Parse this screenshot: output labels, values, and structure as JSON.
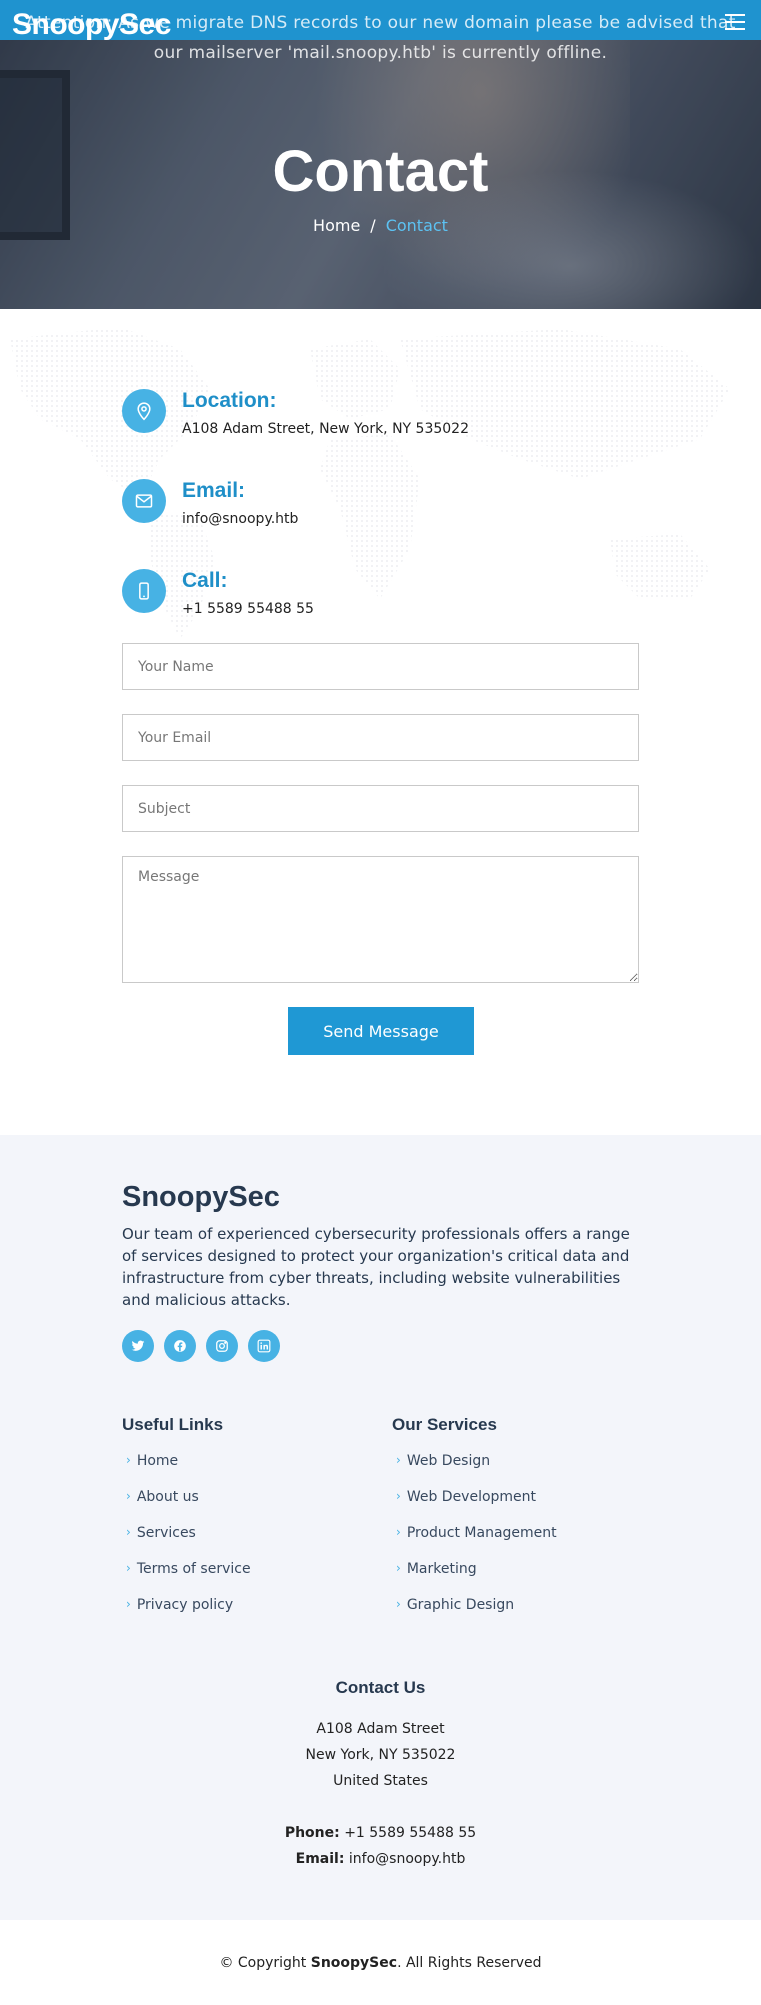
{
  "header": {
    "logo": "SnoopySec",
    "notice": "Attention: As we migrate DNS records to our new domain please be advised that our mailserver 'mail.snoopy.htb' is currently offline."
  },
  "hero": {
    "title": "Contact",
    "breadcrumb": {
      "home": "Home",
      "separator": "/",
      "current": "Contact"
    }
  },
  "contact_info": [
    {
      "icon": "location-pin-icon",
      "title": "Location:",
      "value": "A108 Adam Street, New York, NY 535022"
    },
    {
      "icon": "envelope-icon",
      "title": "Email:",
      "value": "info@snoopy.htb"
    },
    {
      "icon": "phone-icon",
      "title": "Call:",
      "value": "+1 5589 55488 55"
    }
  ],
  "form": {
    "name_placeholder": "Your Name",
    "email_placeholder": "Your Email",
    "subject_placeholder": "Subject",
    "message_placeholder": "Message",
    "submit_label": "Send Message"
  },
  "footer": {
    "brand": "SnoopySec",
    "description": "Our team of experienced cybersecurity professionals offers a range of services designed to protect your organization's critical data and infrastructure from cyber threats, including website vulnerabilities and malicious attacks.",
    "socials": [
      "twitter-icon",
      "facebook-icon",
      "instagram-icon",
      "linkedin-icon"
    ],
    "useful_links": {
      "title": "Useful Links",
      "items": [
        "Home",
        "About us",
        "Services",
        "Terms of service",
        "Privacy policy"
      ]
    },
    "services": {
      "title": "Our Services",
      "items": [
        "Web Design",
        "Web Development",
        "Product Management",
        "Marketing",
        "Graphic Design"
      ]
    },
    "contact": {
      "title": "Contact Us",
      "address1": "A108 Adam Street",
      "address2": "New York, NY 535022",
      "address3": "United States",
      "phone_label": "Phone:",
      "phone": "+1 5589 55488 55",
      "email_label": "Email:",
      "email": "info@snoopy.htb"
    },
    "copyright_prefix": "© Copyright",
    "copyright_brand": "SnoopySec",
    "copyright_suffix": ". All Rights Reserved"
  },
  "colors": {
    "accent": "#47b2e4",
    "topbar": "#1f93cf",
    "heading": "#1f8fc8",
    "footer_bg": "#f3f5fa",
    "footer_text": "#27394f"
  }
}
